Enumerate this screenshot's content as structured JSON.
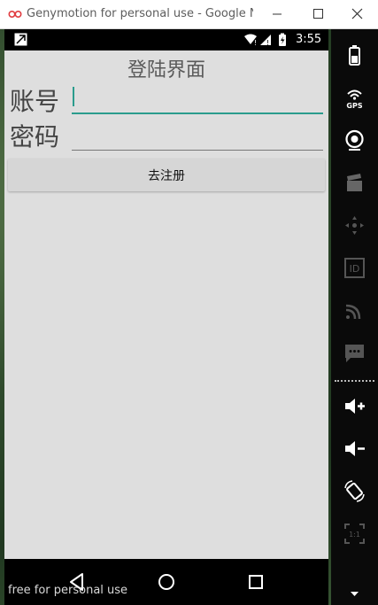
{
  "window": {
    "title": "Genymotion for personal use - Google Ne...",
    "icons": [
      "genymotion-logo-icon",
      "minimize-icon",
      "maximize-icon",
      "close-icon"
    ]
  },
  "status_bar": {
    "time": "3:55",
    "icons": [
      "notification-icon",
      "wifi-icon",
      "signal-icon",
      "battery-icon"
    ]
  },
  "screen": {
    "title": "登陆界面",
    "account_label": "账号",
    "password_label": "密码",
    "account_value": "",
    "password_value": "",
    "register_button": "去注册"
  },
  "nav_bar": {
    "icons": [
      "back-icon",
      "home-icon",
      "recent-apps-icon"
    ]
  },
  "watermark": "free for personal use",
  "side_panel": {
    "labels": {
      "gps": "GPS",
      "id": "ID",
      "scale": "1:1"
    },
    "icons": [
      "battery-widget-icon",
      "gps-icon",
      "camera-icon",
      "clapperboard-icon",
      "dpad-icon",
      "id-icon",
      "cast-icon",
      "sms-icon",
      "volume-up-icon",
      "volume-down-icon",
      "rotate-icon",
      "pixel-perfect-icon",
      "expand-arrow-icon"
    ]
  },
  "colors": {
    "accent": "#2a9c8d",
    "screen_bg": "#dedede",
    "button_bg": "#d6d6d6"
  }
}
